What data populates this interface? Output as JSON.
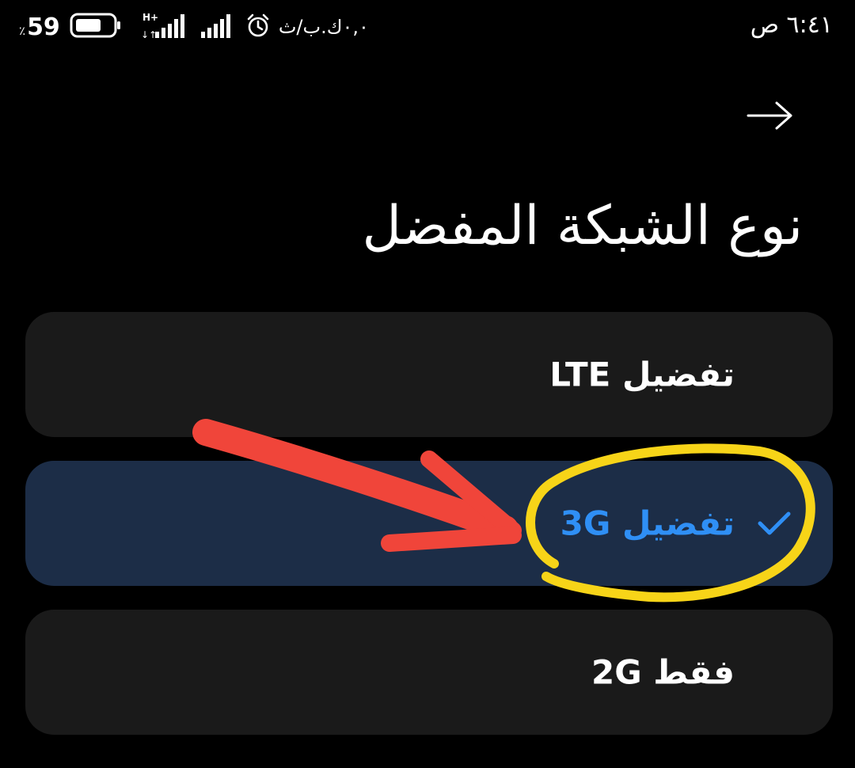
{
  "status_bar": {
    "time": "٦:٤١ ص",
    "battery_percent": "59",
    "percent_sign": "٪",
    "network_type": "H+",
    "net_speed": "٠,٠ك.ب/ث",
    "icons": [
      "battery-icon",
      "signal-bars-icon",
      "signal-bars-icon",
      "alarm-icon"
    ]
  },
  "header": {
    "back_icon": "arrow-right-icon",
    "title": "نوع الشبكة المفضل"
  },
  "options": [
    {
      "label": "تفضيل LTE",
      "selected": false
    },
    {
      "label": "تفضيل 3G",
      "selected": true,
      "icon": "check-icon"
    },
    {
      "label": "2G فقط",
      "selected": false
    }
  ],
  "colors": {
    "background": "#000000",
    "option_background": "#1a1a1a",
    "selected_background": "#1c2d47",
    "accent": "#2f8ff5",
    "annotation_arrow": "#f0453a",
    "annotation_circle": "#f7d418"
  }
}
